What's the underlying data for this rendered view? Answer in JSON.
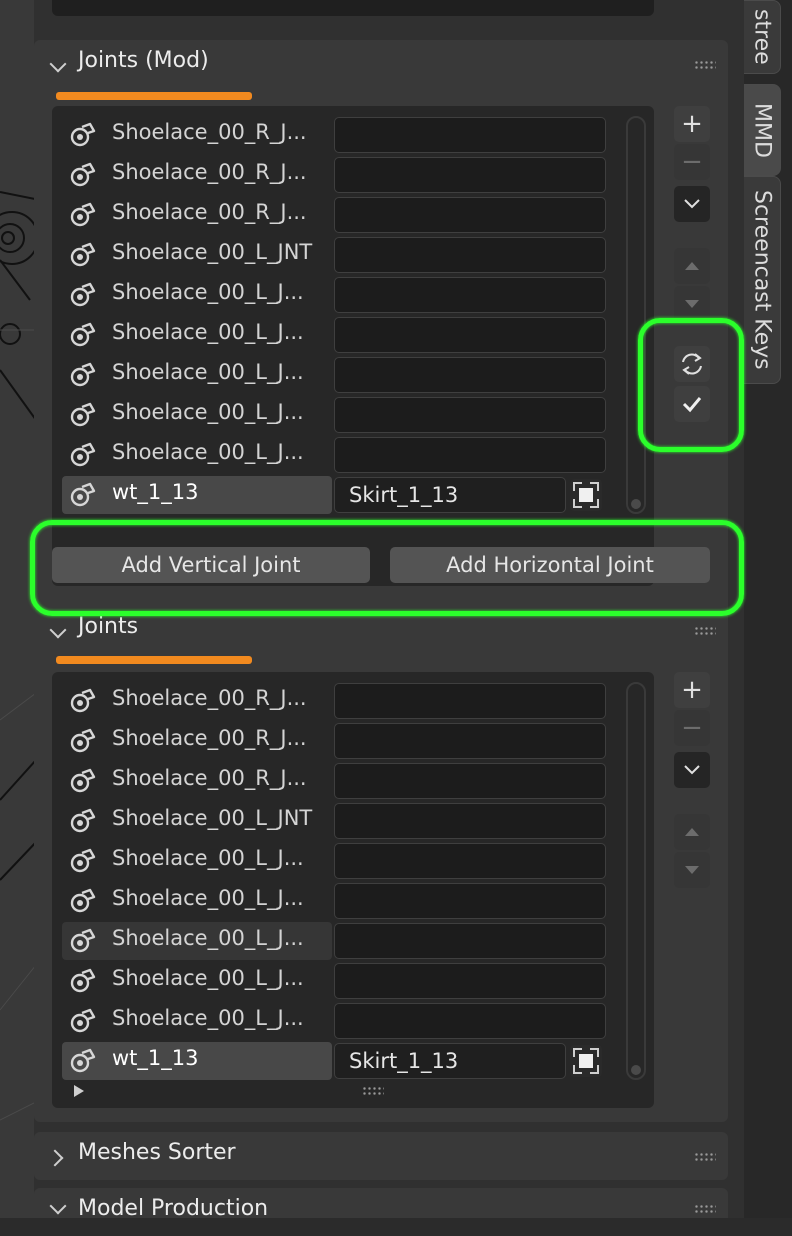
{
  "side_tabs": [
    {
      "label": "stree"
    },
    {
      "label": "MMD"
    },
    {
      "label": "Screencast Keys"
    }
  ],
  "panels": {
    "joints_mod": {
      "title": "Joints (Mod)",
      "rows": [
        {
          "name": "Shoelace_00_R_J...",
          "value": ""
        },
        {
          "name": "Shoelace_00_R_J...",
          "value": ""
        },
        {
          "name": "Shoelace_00_R_J...",
          "value": ""
        },
        {
          "name": "Shoelace_00_L_JNT",
          "value": ""
        },
        {
          "name": "Shoelace_00_L_J...",
          "value": ""
        },
        {
          "name": "Shoelace_00_L_J...",
          "value": ""
        },
        {
          "name": "Shoelace_00_L_J...",
          "value": ""
        },
        {
          "name": "Shoelace_00_L_J...",
          "value": ""
        },
        {
          "name": "Shoelace_00_L_J...",
          "value": ""
        },
        {
          "name": "wt_1_13",
          "value": "Skirt_1_13",
          "active": true
        }
      ],
      "buttons": {
        "add_vertical": "Add Vertical Joint",
        "add_horizontal": "Add Horizontal Joint"
      }
    },
    "joints": {
      "title": "Joints",
      "rows": [
        {
          "name": "Shoelace_00_R_J...",
          "value": ""
        },
        {
          "name": "Shoelace_00_R_J...",
          "value": ""
        },
        {
          "name": "Shoelace_00_R_J...",
          "value": ""
        },
        {
          "name": "Shoelace_00_L_JNT",
          "value": ""
        },
        {
          "name": "Shoelace_00_L_J...",
          "value": ""
        },
        {
          "name": "Shoelace_00_L_J...",
          "value": ""
        },
        {
          "name": "Shoelace_00_L_J...",
          "value": "",
          "hover": true
        },
        {
          "name": "Shoelace_00_L_J...",
          "value": ""
        },
        {
          "name": "Shoelace_00_L_J...",
          "value": ""
        },
        {
          "name": "wt_1_13",
          "value": "Skirt_1_13",
          "active": true
        }
      ]
    },
    "meshes_sorter": {
      "title": "Meshes Sorter"
    },
    "model_production": {
      "title": "Model Production"
    }
  },
  "icons": {
    "row_icon": "rigid-joint-icon",
    "add": "+",
    "remove": "−",
    "sync": "sync-icon",
    "check": "check-icon",
    "pick": "eyedropper-select-icon"
  },
  "colors": {
    "highlight_green": "#2bff2b",
    "underline_orange": "#f28a1f",
    "panel_bg": "#393939",
    "list_bg": "#272727"
  }
}
